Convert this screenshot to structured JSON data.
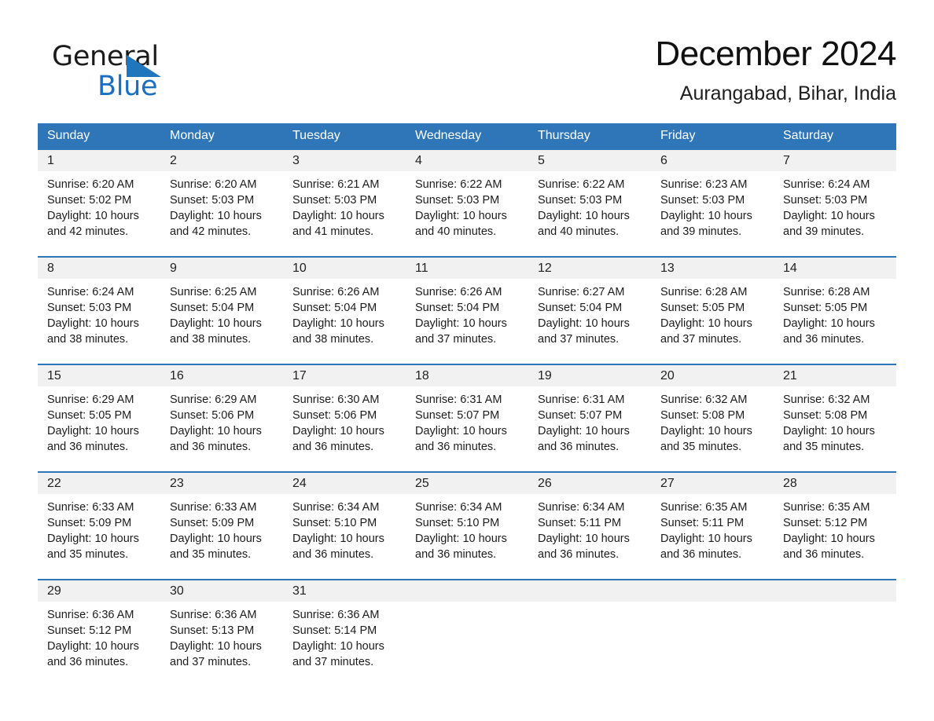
{
  "brand": {
    "name_top": "General",
    "name_bottom": "Blue",
    "accent_color": "#1f76bc"
  },
  "header": {
    "title": "December 2024",
    "location": "Aurangabad, Bihar, India"
  },
  "colors": {
    "header_blue": "#2f76b8",
    "day_band_gray": "#f1f1f1",
    "text": "#1c1c1c"
  },
  "weekdays": [
    "Sunday",
    "Monday",
    "Tuesday",
    "Wednesday",
    "Thursday",
    "Friday",
    "Saturday"
  ],
  "weeks": [
    [
      {
        "day": "1",
        "sunrise": "Sunrise: 6:20 AM",
        "sunset": "Sunset: 5:02 PM",
        "daylight_1": "Daylight: 10 hours",
        "daylight_2": "and 42 minutes."
      },
      {
        "day": "2",
        "sunrise": "Sunrise: 6:20 AM",
        "sunset": "Sunset: 5:03 PM",
        "daylight_1": "Daylight: 10 hours",
        "daylight_2": "and 42 minutes."
      },
      {
        "day": "3",
        "sunrise": "Sunrise: 6:21 AM",
        "sunset": "Sunset: 5:03 PM",
        "daylight_1": "Daylight: 10 hours",
        "daylight_2": "and 41 minutes."
      },
      {
        "day": "4",
        "sunrise": "Sunrise: 6:22 AM",
        "sunset": "Sunset: 5:03 PM",
        "daylight_1": "Daylight: 10 hours",
        "daylight_2": "and 40 minutes."
      },
      {
        "day": "5",
        "sunrise": "Sunrise: 6:22 AM",
        "sunset": "Sunset: 5:03 PM",
        "daylight_1": "Daylight: 10 hours",
        "daylight_2": "and 40 minutes."
      },
      {
        "day": "6",
        "sunrise": "Sunrise: 6:23 AM",
        "sunset": "Sunset: 5:03 PM",
        "daylight_1": "Daylight: 10 hours",
        "daylight_2": "and 39 minutes."
      },
      {
        "day": "7",
        "sunrise": "Sunrise: 6:24 AM",
        "sunset": "Sunset: 5:03 PM",
        "daylight_1": "Daylight: 10 hours",
        "daylight_2": "and 39 minutes."
      }
    ],
    [
      {
        "day": "8",
        "sunrise": "Sunrise: 6:24 AM",
        "sunset": "Sunset: 5:03 PM",
        "daylight_1": "Daylight: 10 hours",
        "daylight_2": "and 38 minutes."
      },
      {
        "day": "9",
        "sunrise": "Sunrise: 6:25 AM",
        "sunset": "Sunset: 5:04 PM",
        "daylight_1": "Daylight: 10 hours",
        "daylight_2": "and 38 minutes."
      },
      {
        "day": "10",
        "sunrise": "Sunrise: 6:26 AM",
        "sunset": "Sunset: 5:04 PM",
        "daylight_1": "Daylight: 10 hours",
        "daylight_2": "and 38 minutes."
      },
      {
        "day": "11",
        "sunrise": "Sunrise: 6:26 AM",
        "sunset": "Sunset: 5:04 PM",
        "daylight_1": "Daylight: 10 hours",
        "daylight_2": "and 37 minutes."
      },
      {
        "day": "12",
        "sunrise": "Sunrise: 6:27 AM",
        "sunset": "Sunset: 5:04 PM",
        "daylight_1": "Daylight: 10 hours",
        "daylight_2": "and 37 minutes."
      },
      {
        "day": "13",
        "sunrise": "Sunrise: 6:28 AM",
        "sunset": "Sunset: 5:05 PM",
        "daylight_1": "Daylight: 10 hours",
        "daylight_2": "and 37 minutes."
      },
      {
        "day": "14",
        "sunrise": "Sunrise: 6:28 AM",
        "sunset": "Sunset: 5:05 PM",
        "daylight_1": "Daylight: 10 hours",
        "daylight_2": "and 36 minutes."
      }
    ],
    [
      {
        "day": "15",
        "sunrise": "Sunrise: 6:29 AM",
        "sunset": "Sunset: 5:05 PM",
        "daylight_1": "Daylight: 10 hours",
        "daylight_2": "and 36 minutes."
      },
      {
        "day": "16",
        "sunrise": "Sunrise: 6:29 AM",
        "sunset": "Sunset: 5:06 PM",
        "daylight_1": "Daylight: 10 hours",
        "daylight_2": "and 36 minutes."
      },
      {
        "day": "17",
        "sunrise": "Sunrise: 6:30 AM",
        "sunset": "Sunset: 5:06 PM",
        "daylight_1": "Daylight: 10 hours",
        "daylight_2": "and 36 minutes."
      },
      {
        "day": "18",
        "sunrise": "Sunrise: 6:31 AM",
        "sunset": "Sunset: 5:07 PM",
        "daylight_1": "Daylight: 10 hours",
        "daylight_2": "and 36 minutes."
      },
      {
        "day": "19",
        "sunrise": "Sunrise: 6:31 AM",
        "sunset": "Sunset: 5:07 PM",
        "daylight_1": "Daylight: 10 hours",
        "daylight_2": "and 36 minutes."
      },
      {
        "day": "20",
        "sunrise": "Sunrise: 6:32 AM",
        "sunset": "Sunset: 5:08 PM",
        "daylight_1": "Daylight: 10 hours",
        "daylight_2": "and 35 minutes."
      },
      {
        "day": "21",
        "sunrise": "Sunrise: 6:32 AM",
        "sunset": "Sunset: 5:08 PM",
        "daylight_1": "Daylight: 10 hours",
        "daylight_2": "and 35 minutes."
      }
    ],
    [
      {
        "day": "22",
        "sunrise": "Sunrise: 6:33 AM",
        "sunset": "Sunset: 5:09 PM",
        "daylight_1": "Daylight: 10 hours",
        "daylight_2": "and 35 minutes."
      },
      {
        "day": "23",
        "sunrise": "Sunrise: 6:33 AM",
        "sunset": "Sunset: 5:09 PM",
        "daylight_1": "Daylight: 10 hours",
        "daylight_2": "and 35 minutes."
      },
      {
        "day": "24",
        "sunrise": "Sunrise: 6:34 AM",
        "sunset": "Sunset: 5:10 PM",
        "daylight_1": "Daylight: 10 hours",
        "daylight_2": "and 36 minutes."
      },
      {
        "day": "25",
        "sunrise": "Sunrise: 6:34 AM",
        "sunset": "Sunset: 5:10 PM",
        "daylight_1": "Daylight: 10 hours",
        "daylight_2": "and 36 minutes."
      },
      {
        "day": "26",
        "sunrise": "Sunrise: 6:34 AM",
        "sunset": "Sunset: 5:11 PM",
        "daylight_1": "Daylight: 10 hours",
        "daylight_2": "and 36 minutes."
      },
      {
        "day": "27",
        "sunrise": "Sunrise: 6:35 AM",
        "sunset": "Sunset: 5:11 PM",
        "daylight_1": "Daylight: 10 hours",
        "daylight_2": "and 36 minutes."
      },
      {
        "day": "28",
        "sunrise": "Sunrise: 6:35 AM",
        "sunset": "Sunset: 5:12 PM",
        "daylight_1": "Daylight: 10 hours",
        "daylight_2": "and 36 minutes."
      }
    ],
    [
      {
        "day": "29",
        "sunrise": "Sunrise: 6:36 AM",
        "sunset": "Sunset: 5:12 PM",
        "daylight_1": "Daylight: 10 hours",
        "daylight_2": "and 36 minutes."
      },
      {
        "day": "30",
        "sunrise": "Sunrise: 6:36 AM",
        "sunset": "Sunset: 5:13 PM",
        "daylight_1": "Daylight: 10 hours",
        "daylight_2": "and 37 minutes."
      },
      {
        "day": "31",
        "sunrise": "Sunrise: 6:36 AM",
        "sunset": "Sunset: 5:14 PM",
        "daylight_1": "Daylight: 10 hours",
        "daylight_2": "and 37 minutes."
      },
      {
        "day": "",
        "sunrise": "",
        "sunset": "",
        "daylight_1": "",
        "daylight_2": ""
      },
      {
        "day": "",
        "sunrise": "",
        "sunset": "",
        "daylight_1": "",
        "daylight_2": ""
      },
      {
        "day": "",
        "sunrise": "",
        "sunset": "",
        "daylight_1": "",
        "daylight_2": ""
      },
      {
        "day": "",
        "sunrise": "",
        "sunset": "",
        "daylight_1": "",
        "daylight_2": ""
      }
    ]
  ]
}
